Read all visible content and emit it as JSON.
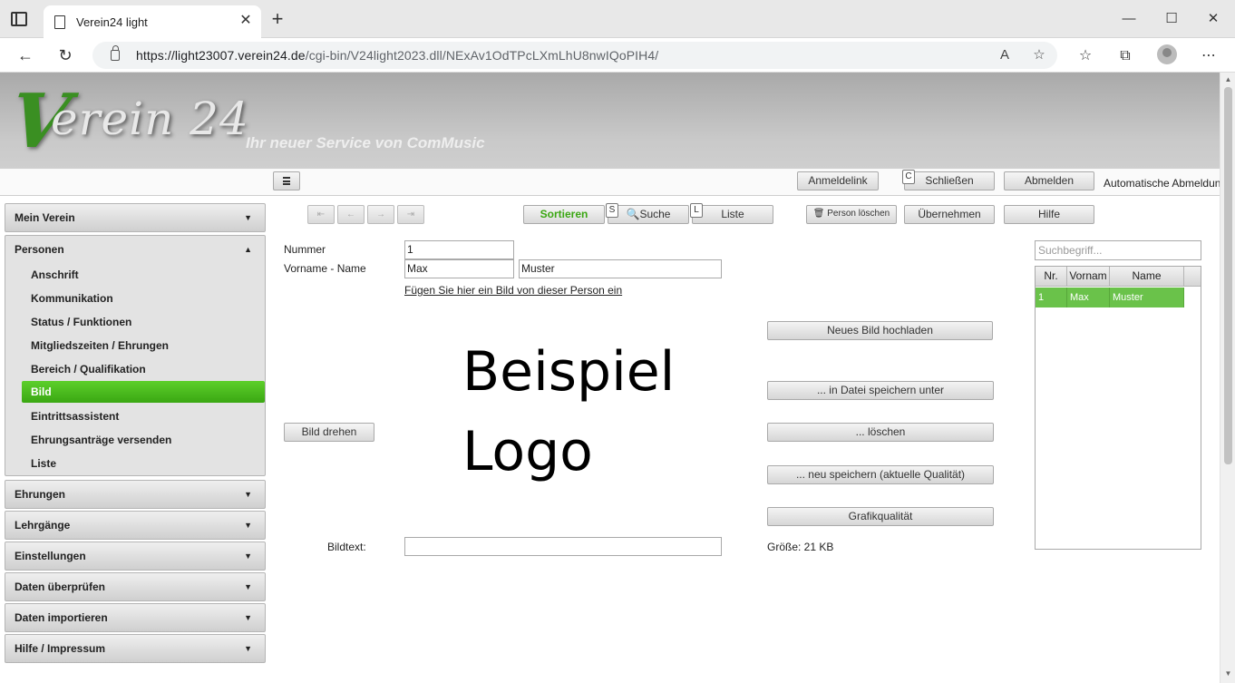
{
  "browser": {
    "tab_title": "Verein24 light",
    "url_host": "https://light23007.verein24.de",
    "url_path": "/cgi-bin/V24light2023.dll/NExAv1OdTPcLXmLhU8nwIQoPIH4/"
  },
  "banner": {
    "logo_v": "V",
    "logo_rest": "erein 24",
    "tagline": "Ihr neuer Service von ComMusic"
  },
  "topbar": {
    "anmeldelink": "Anmeldelink",
    "schliessen": "Schließen",
    "schliessen_key": "C",
    "abmelden": "Abmelden",
    "auto_logout": "Automatische Abmeldung"
  },
  "sidebar": {
    "mein_verein": "Mein Verein",
    "personen": "Personen",
    "personen_items": [
      "Anschrift",
      "Kommunikation",
      "Status / Funktionen",
      "Mitgliedszeiten / Ehrungen",
      "Bereich / Qualifikation",
      "Bild",
      "Eintrittsassistent",
      "Ehrungsanträge versenden",
      "Liste"
    ],
    "sections": [
      "Ehrungen",
      "Lehrgänge",
      "Einstellungen",
      "Daten überprüfen",
      "Daten importieren",
      "Hilfe / Impressum"
    ]
  },
  "toolbar": {
    "sortieren": "Sortieren",
    "suche": "Suche",
    "suche_key": "S",
    "liste": "Liste",
    "liste_key": "L",
    "person_loeschen": "Person löschen",
    "uebernehmen": "Übernehmen",
    "hilfe": "Hilfe",
    "nav_first": "⇤",
    "nav_prev": "←",
    "nav_next": "→",
    "nav_last": "⇥"
  },
  "form": {
    "nummer_label": "Nummer",
    "nummer_value": "1",
    "name_label": "Vorname - Name",
    "vorname_value": "Max",
    "nachname_value": "Muster",
    "add_image_link": "Fügen Sie hier ein Bild von dieser Person ein",
    "logo_line1": "Beispiel",
    "logo_line2": "Logo",
    "bild_drehen": "Bild drehen",
    "neues_bild": "Neues Bild hochladen",
    "datei_speichern": "... in Datei speichern unter",
    "loeschen": "... löschen",
    "neu_speichern": "... neu speichern (aktuelle Qualität)",
    "grafikqualitaet": "Grafikqualität",
    "bildtext_label": "Bildtext:",
    "bildtext_value": "",
    "groesse": "Größe: 21 KB"
  },
  "search": {
    "placeholder": "Suchbegriff...",
    "columns": [
      "Nr.",
      "Vornam",
      "Name"
    ],
    "rows": [
      [
        "1",
        "Max",
        "Muster"
      ]
    ]
  }
}
